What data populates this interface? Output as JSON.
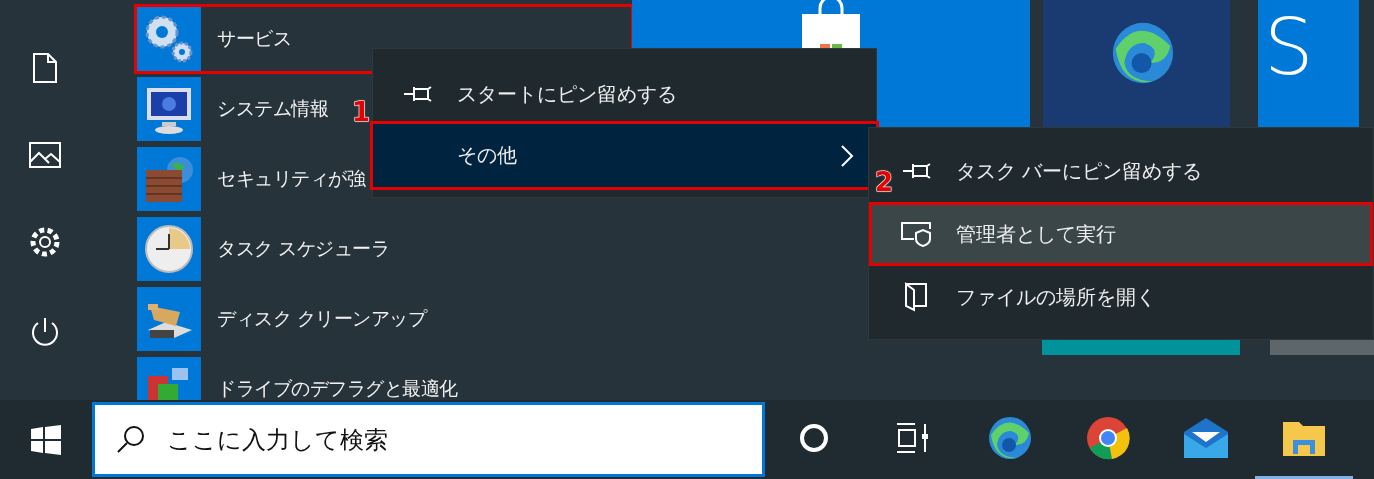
{
  "app_list": [
    {
      "label": "サービス",
      "marked": true
    },
    {
      "label": "システム情報",
      "marked": false
    },
    {
      "label": "セキュリティが強",
      "marked": false
    },
    {
      "label": "タスク スケジューラ",
      "marked": false
    },
    {
      "label": "ディスク クリーンアップ",
      "marked": false
    },
    {
      "label": "ドライブのデフラグと最適化",
      "marked": false
    }
  ],
  "tiles": [
    {
      "label": "S"
    }
  ],
  "context_menu": {
    "items": [
      {
        "label": "スタートにピン留めする",
        "selected": false,
        "marked": false
      },
      {
        "label": "その他",
        "selected": true,
        "marked": true,
        "callout": "1"
      }
    ]
  },
  "submenu": {
    "items": [
      {
        "label": "タスク バーにピン留めする",
        "selected": false,
        "marked": false
      },
      {
        "label": "管理者として実行",
        "selected": true,
        "marked": true,
        "callout": "2"
      },
      {
        "label": "ファイルの場所を開く",
        "selected": false,
        "marked": false
      }
    ]
  },
  "search": {
    "placeholder": "ここに入力して検索"
  },
  "taskbar_apps": [
    {
      "running": false
    },
    {
      "running": false
    },
    {
      "running": false
    },
    {
      "running": false
    },
    {
      "running": false
    },
    {
      "running": true
    }
  ]
}
